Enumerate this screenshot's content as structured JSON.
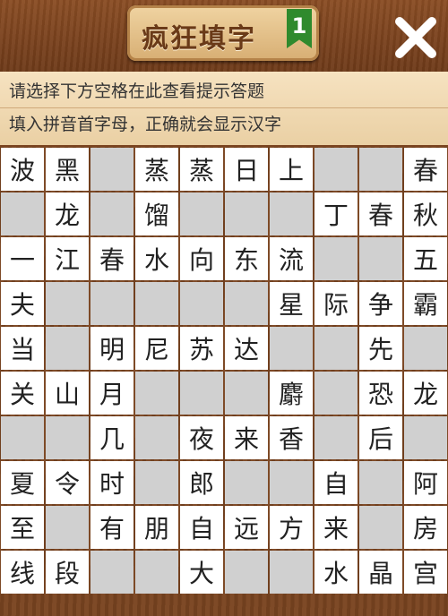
{
  "header": {
    "title": "疯狂填字",
    "level": "1",
    "close_icon": "close-icon"
  },
  "hints": {
    "line1": "请选择下方空格在此查看提示答题",
    "line2": "填入拼音首字母，正确就会显示汉字"
  },
  "grid": {
    "legend": {
      "#": "blocked",
      "?": "empty-input-cell"
    },
    "rows": [
      [
        "波",
        "黑",
        "?",
        "蒸",
        "蒸",
        "日",
        "上",
        "?",
        "?",
        "春"
      ],
      [
        "?",
        "龙",
        "?",
        "馏",
        "?",
        "?",
        "?",
        "丁",
        "春",
        "秋"
      ],
      [
        "一",
        "江",
        "春",
        "水",
        "向",
        "东",
        "流",
        "?",
        "?",
        "五"
      ],
      [
        "夫",
        "?",
        "?",
        "?",
        "?",
        "?",
        "星",
        "际",
        "争",
        "霸"
      ],
      [
        "当",
        "?",
        "明",
        "尼",
        "苏",
        "达",
        "?",
        "?",
        "先",
        "?"
      ],
      [
        "关",
        "山",
        "月",
        "?",
        "?",
        "?",
        "麝",
        "?",
        "恐",
        "龙"
      ],
      [
        "?",
        "?",
        "几",
        "?",
        "夜",
        "来",
        "香",
        "?",
        "后",
        "?"
      ],
      [
        "夏",
        "令",
        "时",
        "?",
        "郎",
        "?",
        "?",
        "自",
        "?",
        "阿"
      ],
      [
        "至",
        "?",
        "有",
        "朋",
        "自",
        "远",
        "方",
        "来",
        "?",
        "房"
      ],
      [
        "线",
        "段",
        "?",
        "?",
        "大",
        "?",
        "?",
        "水",
        "晶",
        "宫"
      ]
    ]
  }
}
